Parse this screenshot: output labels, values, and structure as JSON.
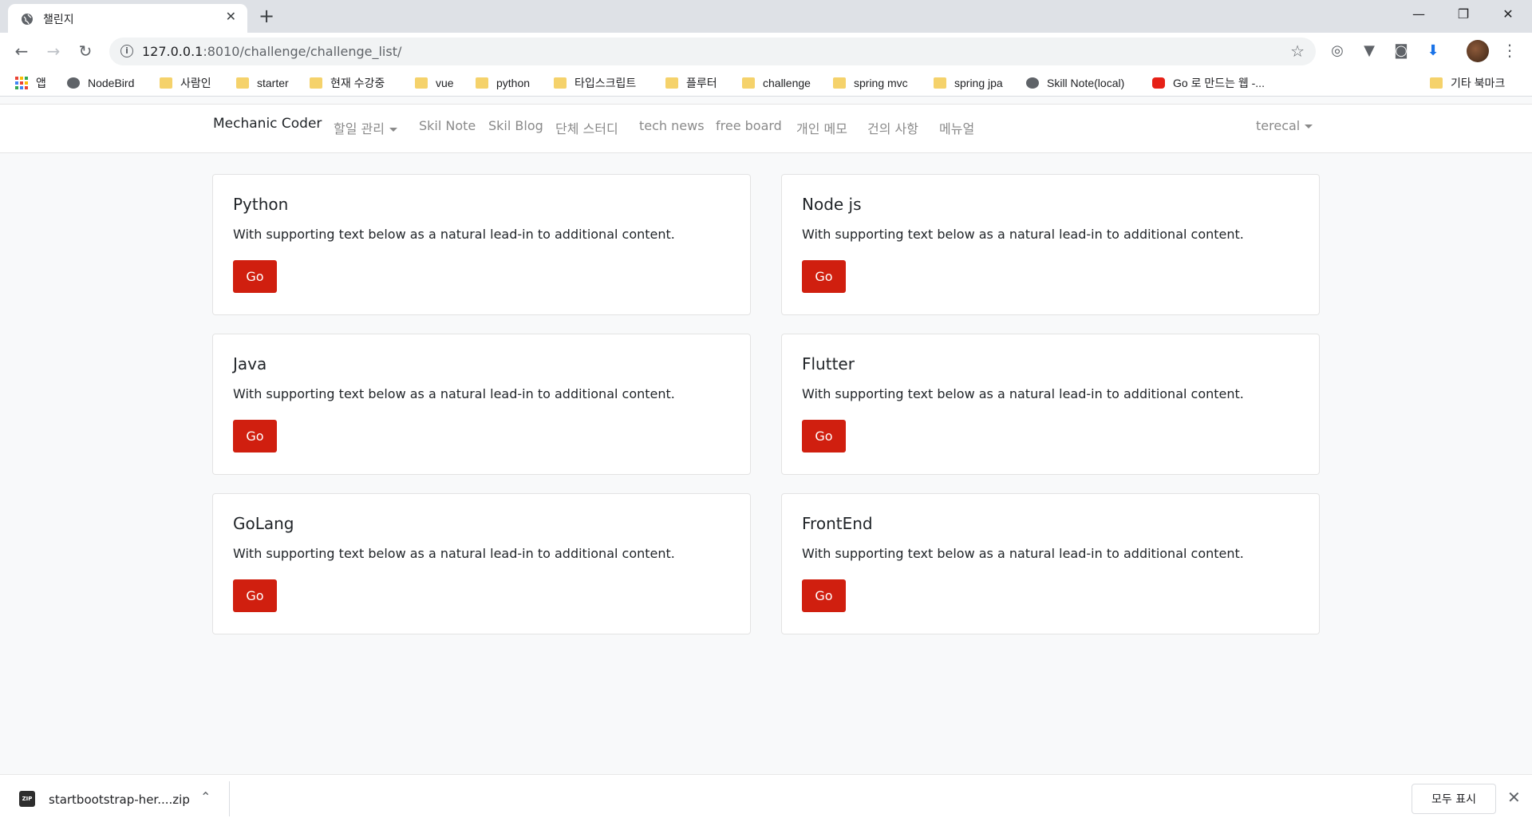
{
  "browser": {
    "tab_title": "챌린지",
    "tab_close": "✕",
    "new_tab": "+",
    "window_controls": {
      "minimize": "—",
      "restore": "❐",
      "close": "✕"
    },
    "url_host": "127.0.0.1",
    "url_path": ":8010/challenge/challenge_list/",
    "icons": [
      "back-icon",
      "forward-icon",
      "reload-icon",
      "info-icon",
      "star-icon",
      "extension-icons",
      "avatar",
      "menu-icon"
    ]
  },
  "bookmarks": [
    {
      "label": "앱",
      "icon": "apps"
    },
    {
      "label": "NodeBird",
      "icon": "globe"
    },
    {
      "label": "사람인",
      "icon": "folder"
    },
    {
      "label": "starter",
      "icon": "folder"
    },
    {
      "label": "현재 수강중",
      "icon": "folder"
    },
    {
      "label": "vue",
      "icon": "folder"
    },
    {
      "label": "python",
      "icon": "folder"
    },
    {
      "label": "타입스크립트",
      "icon": "folder"
    },
    {
      "label": "플루터",
      "icon": "folder"
    },
    {
      "label": "challenge",
      "icon": "folder"
    },
    {
      "label": "spring mvc",
      "icon": "folder"
    },
    {
      "label": "spring jpa",
      "icon": "folder"
    },
    {
      "label": "Skill Note(local)",
      "icon": "globe"
    },
    {
      "label": "Go 로 만드는 웹 -...",
      "icon": "youtube"
    },
    {
      "label": "기타 북마크",
      "icon": "folder"
    }
  ],
  "navbar": {
    "brand": "Mechanic Coder",
    "links": [
      "할일 관리",
      "Skil Note",
      "Skil Blog",
      "단체 스터디",
      "tech news",
      "free board",
      "개인 메모",
      "건의 사항",
      "메뉴얼"
    ],
    "user": "terecal"
  },
  "cards": [
    {
      "title": "Python",
      "text": "With supporting text below as a natural lead-in to additional content.",
      "button": "Go"
    },
    {
      "title": "Node js",
      "text": "With supporting text below as a natural lead-in to additional content.",
      "button": "Go"
    },
    {
      "title": "Java",
      "text": "With supporting text below as a natural lead-in to additional content.",
      "button": "Go"
    },
    {
      "title": "Flutter",
      "text": "With supporting text below as a natural lead-in to additional content.",
      "button": "Go"
    },
    {
      "title": "GoLang",
      "text": "With supporting text below as a natural lead-in to additional content.",
      "button": "Go"
    },
    {
      "title": "FrontEnd",
      "text": "With supporting text below as a natural lead-in to additional content.",
      "button": "Go"
    }
  ],
  "downloads": {
    "file_name": "startbootstrap-her....zip",
    "file_badge": "ZIP",
    "show_all": "모두 표시",
    "close": "✕"
  },
  "colors": {
    "go_button": "#d01f0f",
    "page_bg": "#f8f9fa",
    "nav_link": "#8a8a8a"
  }
}
